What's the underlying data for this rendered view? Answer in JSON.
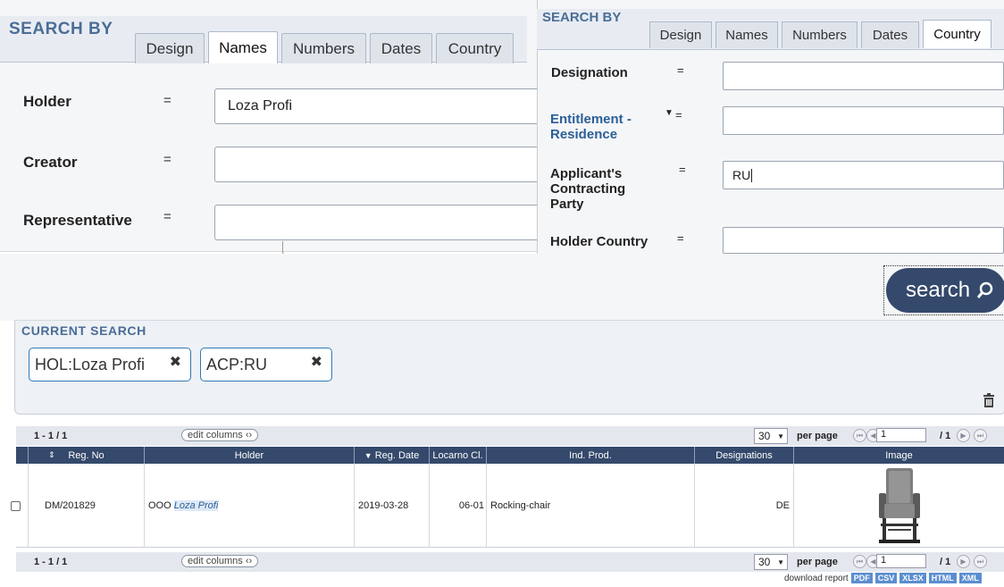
{
  "left_panel": {
    "title": "SEARCH BY",
    "tabs": [
      "Design",
      "Names",
      "Numbers",
      "Dates",
      "Country"
    ],
    "active_tab": "Names",
    "fields": [
      {
        "label": "Holder",
        "operator": "=",
        "value": "Loza Profi"
      },
      {
        "label": "Creator",
        "operator": "=",
        "value": ""
      },
      {
        "label": "Representative",
        "operator": "=",
        "value": ""
      }
    ]
  },
  "right_panel": {
    "title": "SEARCH BY",
    "tabs": [
      "Design",
      "Names",
      "Numbers",
      "Dates",
      "Country"
    ],
    "active_tab": "Country",
    "fields": [
      {
        "label": "Designation",
        "operator": "=",
        "value": ""
      },
      {
        "label": "Entitlement - Residence",
        "operator": "=",
        "value": ""
      },
      {
        "label": "Applicant's Contracting Party",
        "operator": "=",
        "value": "RU"
      },
      {
        "label": "Holder Country",
        "operator": "=",
        "value": ""
      }
    ]
  },
  "search_button": {
    "label": "search",
    "icon": "search-icon"
  },
  "current_search": {
    "title": "CURRENT SEARCH",
    "chips": [
      {
        "label": "HOL:Loza Profi"
      },
      {
        "label": "ACP:RU"
      }
    ],
    "trash_icon": "trash-icon"
  },
  "pager": {
    "count": "1 - 1 / 1",
    "edit_columns": "edit columns",
    "per_page_value": "30",
    "per_page_label": "per page",
    "page_input": "1",
    "page_total": "/ 1"
  },
  "table": {
    "headers": [
      "Reg. No",
      "Holder",
      "Reg. Date",
      "Locarno Cl.",
      "Ind. Prod.",
      "Designations",
      "Image"
    ],
    "rows": [
      {
        "reg_no": "DM/201829",
        "holder_prefix": "OOO",
        "holder_match": "Loza Profi",
        "reg_date": "2019-03-28",
        "locarno": "06-01",
        "ind_prod": "Rocking-chair",
        "designations": "DE",
        "image": "rocking-chair-image"
      }
    ]
  },
  "download": {
    "label": "download report",
    "formats": [
      "PDF",
      "CSV",
      "XLSX",
      "HTML",
      "XML"
    ]
  },
  "colors": {
    "navy": "#34496b",
    "title_blue": "#4a6d98",
    "chip_border": "#2f7ab8"
  }
}
